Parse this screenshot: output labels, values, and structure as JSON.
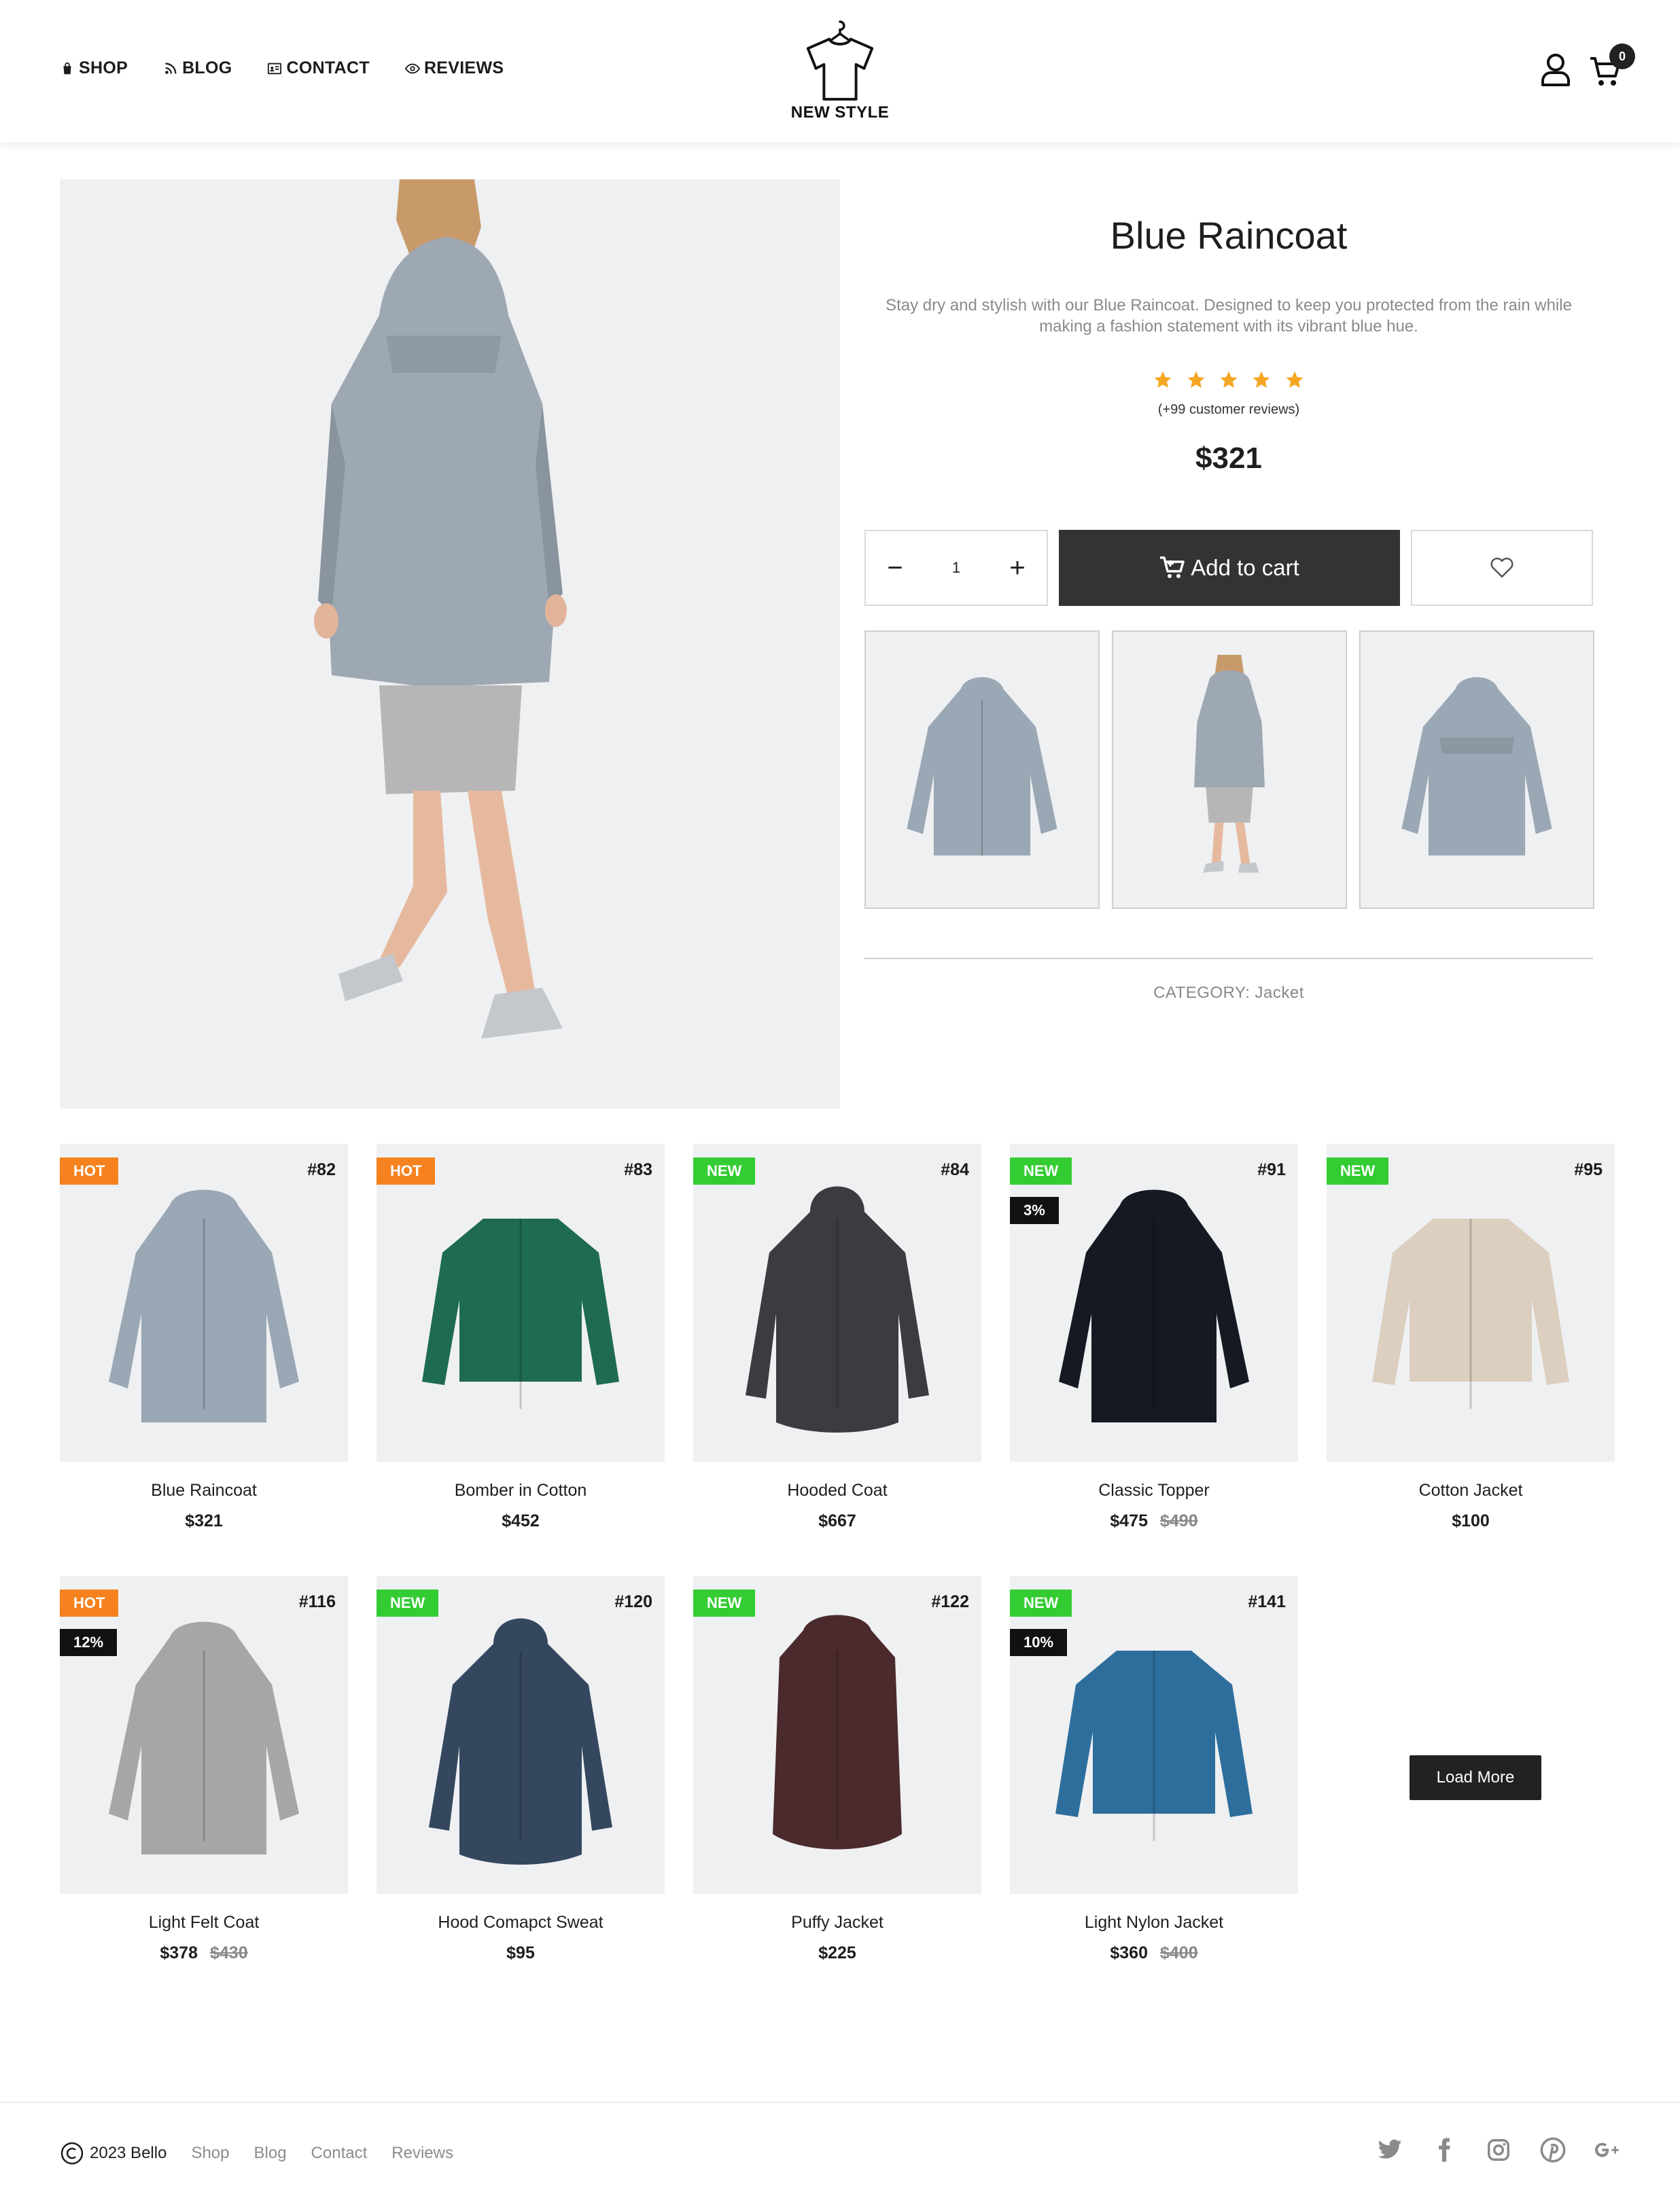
{
  "header": {
    "nav": [
      {
        "label": "SHOP",
        "icon": "shopping-bag-icon"
      },
      {
        "label": "BLOG",
        "icon": "rss-icon"
      },
      {
        "label": "CONTACT",
        "icon": "address-card-icon"
      },
      {
        "label": "REVIEWS",
        "icon": "eye-icon"
      }
    ],
    "logo_text": "NEW STYLE",
    "cart_count": "0"
  },
  "product": {
    "title": "Blue Raincoat",
    "description": "Stay dry and stylish with our Blue Raincoat. Designed to keep you protected from the rain while making a fashion statement with its vibrant blue hue.",
    "rating": 5,
    "reviews": "(+99 customer reviews)",
    "price": "$321",
    "quantity": "1",
    "add_to_cart": "Add to cart",
    "category": "CATEGORY: Jacket",
    "star_color": "#f5a623"
  },
  "products": [
    {
      "id": "#82",
      "badge": "HOT",
      "badge_type": "hot",
      "discount": "",
      "name": "Blue Raincoat",
      "price": "$321",
      "old_price": "",
      "color": "#9aa7b4"
    },
    {
      "id": "#83",
      "badge": "HOT",
      "badge_type": "hot",
      "discount": "",
      "name": "Bomber in Cotton",
      "price": "$452",
      "old_price": "",
      "color": "#1f6b52"
    },
    {
      "id": "#84",
      "badge": "NEW",
      "badge_type": "new",
      "discount": "",
      "name": "Hooded Coat",
      "price": "$667",
      "old_price": "",
      "color": "#3a3c3f"
    },
    {
      "id": "#91",
      "badge": "NEW",
      "badge_type": "new",
      "discount": "3%",
      "name": "Classic Topper",
      "price": "$475",
      "old_price": "$490",
      "color": "#141922"
    },
    {
      "id": "#95",
      "badge": "NEW",
      "badge_type": "new",
      "discount": "",
      "name": "Cotton Jacket",
      "price": "$100",
      "old_price": "",
      "color": "#dccfc0"
    },
    {
      "id": "#116",
      "badge": "HOT",
      "badge_type": "hot",
      "discount": "12%",
      "name": "Light Felt Coat",
      "price": "$378",
      "old_price": "$430",
      "color": "#a6a6a6"
    },
    {
      "id": "#120",
      "badge": "NEW",
      "badge_type": "new",
      "discount": "",
      "name": "Hood Comapct Sweat",
      "price": "$95",
      "old_price": "",
      "color": "#34475f"
    },
    {
      "id": "#122",
      "badge": "NEW",
      "badge_type": "new",
      "discount": "",
      "name": "Puffy Jacket",
      "price": "$225",
      "old_price": "",
      "color": "#4a2a2c"
    },
    {
      "id": "#141",
      "badge": "NEW",
      "badge_type": "new",
      "discount": "10%",
      "name": "Light Nylon Jacket",
      "price": "$360",
      "old_price": "$400",
      "color": "#2d6e9c"
    }
  ],
  "load_more": "Load More",
  "footer": {
    "copyright": "2023 Bello",
    "links": [
      "Shop",
      "Blog",
      "Contact",
      "Reviews"
    ],
    "socials": [
      "twitter-icon",
      "facebook-icon",
      "instagram-icon",
      "pinterest-icon",
      "google-plus-icon"
    ]
  }
}
